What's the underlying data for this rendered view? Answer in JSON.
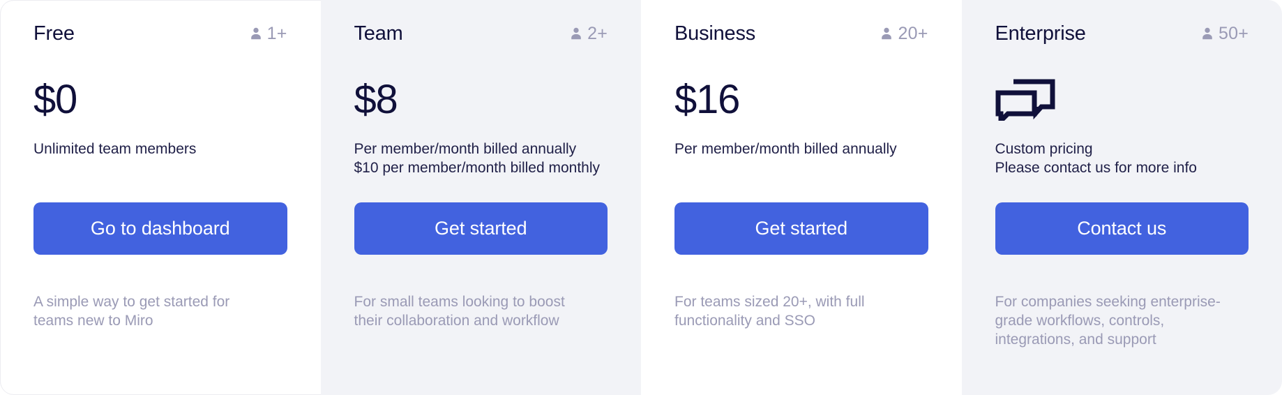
{
  "plans": [
    {
      "id": "free",
      "name": "Free",
      "seats": "1+",
      "seats_icon": "person-icon",
      "price": "$0",
      "price_is_icon": false,
      "billing": [
        "Unlimited team members"
      ],
      "cta": "Go to dashboard",
      "blurb": "A simple way to get started for teams new to Miro",
      "shaded": false
    },
    {
      "id": "team",
      "name": "Team",
      "seats": "2+",
      "seats_icon": "person-icon",
      "price": "$8",
      "price_is_icon": false,
      "billing": [
        "Per member/month billed annually",
        "$10 per member/month billed monthly"
      ],
      "cta": "Get started",
      "blurb": "For small teams looking to boost their collaboration and workflow",
      "shaded": true
    },
    {
      "id": "business",
      "name": "Business",
      "seats": "20+",
      "seats_icon": "person-icon",
      "price": "$16",
      "price_is_icon": false,
      "billing": [
        "Per member/month billed annually"
      ],
      "cta": "Get started",
      "blurb": "For teams sized 20+, with full functionality and SSO",
      "shaded": false
    },
    {
      "id": "enterprise",
      "name": "Enterprise",
      "seats": "50+",
      "seats_icon": "person-icon",
      "price": "",
      "price_is_icon": true,
      "price_icon": "chat-bubbles-icon",
      "billing": [
        "Custom pricing",
        "Please contact us for more info"
      ],
      "cta": "Contact us",
      "blurb": "For companies seeking enterprise-grade workflows, controls, integrations, and support",
      "shaded": true
    }
  ],
  "colors": {
    "accent": "#4262df",
    "text_primary": "#10103a",
    "text_muted": "#9a9ab5",
    "card_shaded_bg": "#f2f3f7",
    "card_plain_bg": "#ffffff"
  }
}
